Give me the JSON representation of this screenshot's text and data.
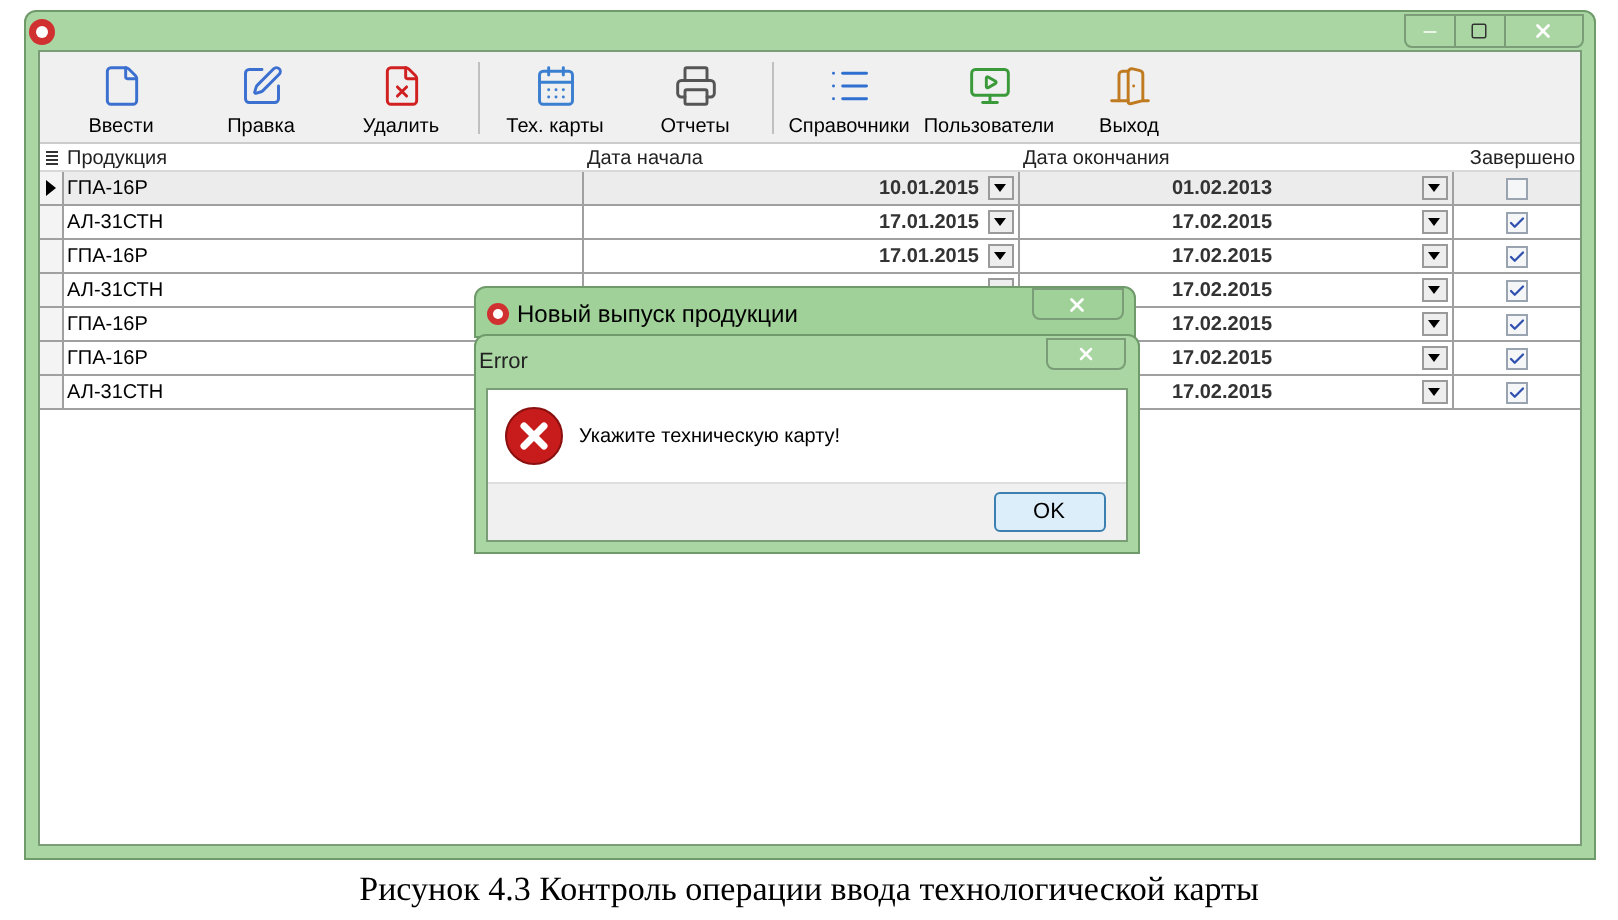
{
  "toolbar": [
    {
      "label": "Ввести",
      "kind": "new",
      "separator_after": false
    },
    {
      "label": "Правка",
      "kind": "edit",
      "separator_after": false
    },
    {
      "label": "Удалить",
      "kind": "delete",
      "separator_after": true
    },
    {
      "label": "Тех. карты",
      "kind": "calendar",
      "separator_after": false
    },
    {
      "label": "Отчеты",
      "kind": "printer",
      "separator_after": true
    },
    {
      "label": "Справочники",
      "kind": "list",
      "separator_after": false
    },
    {
      "label": "Пользователи",
      "kind": "users",
      "separator_after": false
    },
    {
      "label": "Выход",
      "kind": "exit",
      "separator_after": false
    }
  ],
  "table": {
    "columns": [
      "Продукция",
      "Дата начала",
      "Дата окончания",
      "Завершено"
    ],
    "rows": [
      {
        "product": "ГПА-16Р",
        "start_date": "10.01.2015",
        "end_date": "01.02.2013",
        "completed": false,
        "selected": true
      },
      {
        "product": "АЛ-31СТН",
        "start_date": "17.01.2015",
        "end_date": "17.02.2015",
        "completed": true,
        "selected": false
      },
      {
        "product": "ГПА-16Р",
        "start_date": "17.01.2015",
        "end_date": "17.02.2015",
        "completed": true,
        "selected": false
      },
      {
        "product": "АЛ-31СТН",
        "start_picker": true,
        "end_date": "17.02.2015",
        "completed": true,
        "selected": false
      },
      {
        "product": "ГПА-16Р",
        "start_picker": false,
        "end_date": "17.02.2015",
        "completed": true,
        "selected": false
      },
      {
        "product": "ГПА-16Р",
        "start_picker": false,
        "end_date": "17.02.2015",
        "completed": true,
        "selected": false
      },
      {
        "product": "АЛ-31СТН",
        "start_picker": false,
        "end_date": "17.02.2015",
        "completed": true,
        "selected": false
      }
    ]
  },
  "parent_dialog": {
    "title": "Новый выпуск продукции"
  },
  "error_dialog": {
    "title": "Error",
    "message": "Укажите техническую карту!",
    "button": "OK"
  },
  "caption": "Рисунок 4.3 Контроль операции ввода технологической карты"
}
